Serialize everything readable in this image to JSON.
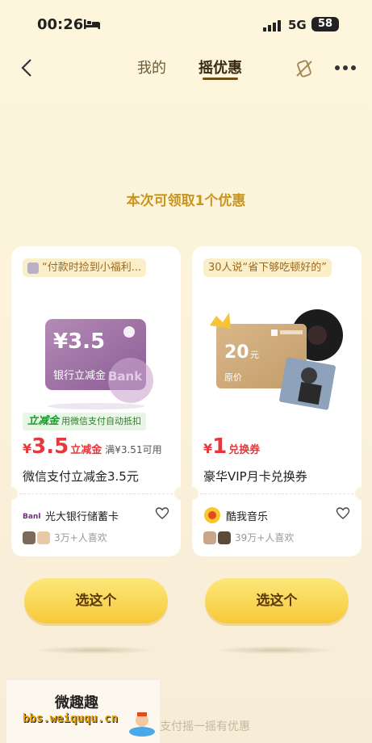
{
  "status_bar": {
    "time": "00:26",
    "network": "5G",
    "battery": "58"
  },
  "nav": {
    "tabs": [
      {
        "label": "我的"
      },
      {
        "label": "摇优惠"
      }
    ]
  },
  "headline": "本次可领取1个优惠",
  "cards": [
    {
      "quote": "“付款时捡到小福利...",
      "product": {
        "amount": "¥3.5",
        "label": "银行立减金",
        "badge": "Bank"
      },
      "tag": {
        "strong": "立减金",
        "text": "用微信支付自动抵扣"
      },
      "price": {
        "currency": "¥",
        "value": "3.5",
        "tag": "立减金",
        "condition": "满¥3.51可用"
      },
      "title": "微信支付立减金3.5元",
      "merchant": {
        "name": "光大银行储蓄卡",
        "logo_text": "Bank"
      },
      "likes": "3万+人喜欢"
    },
    {
      "quote": "30人说“省下够吃顿好的”",
      "product": {
        "amount": "20",
        "unit": "元",
        "label": "原价"
      },
      "price": {
        "currency": "¥",
        "value": "1",
        "tag": "兑换券"
      },
      "title": "豪华VIP月卡兑换券",
      "merchant": {
        "name": "酷我音乐"
      },
      "likes": "39万+人喜欢"
    }
  ],
  "buttons": {
    "select_label": "选这个"
  },
  "footer": {
    "text": "支付摇一摇有优惠"
  },
  "watermark": {
    "title": "微趣趣",
    "url": "bbs.weiququ.cn"
  },
  "colors": {
    "accent": "#c9951e",
    "price": "#e4393c",
    "button": "#f6c93a"
  }
}
